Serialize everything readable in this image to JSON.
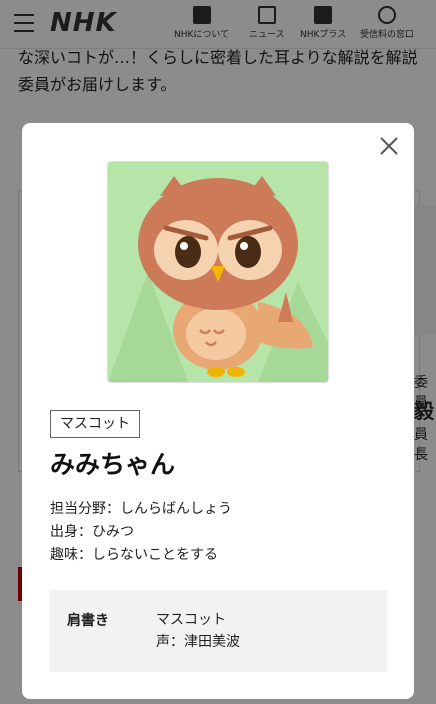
{
  "header": {
    "logo": "NHK",
    "nav": [
      {
        "label": "NHKについて",
        "icon": "nhk-tv-icon"
      },
      {
        "label": "ニュース",
        "icon": "newspaper-icon"
      },
      {
        "label": "NHKプラス",
        "icon": "nhk-plus-icon"
      },
      {
        "label": "受信料の窓口",
        "icon": "receipt-icon"
      }
    ]
  },
  "page": {
    "lead": "な深いコトが…！くらしに密着した耳よりな解説を解説委員がお届けします。",
    "side_texts": [
      "委員",
      "毅",
      "員長"
    ]
  },
  "modal": {
    "tag": "マスコット",
    "name": "みみちゃん",
    "details": [
      "担当分野：しんらばんしょう",
      "出身：ひみつ",
      "趣味：しらないことをする"
    ],
    "profile": {
      "label": "肩書き",
      "values": [
        "マスコット",
        "声：津田美波"
      ]
    }
  },
  "colors": {
    "portrait_bg": "#b7e4a8",
    "owl_body": "#cc7a57",
    "overlay": "rgba(0,0,0,0.45)"
  }
}
